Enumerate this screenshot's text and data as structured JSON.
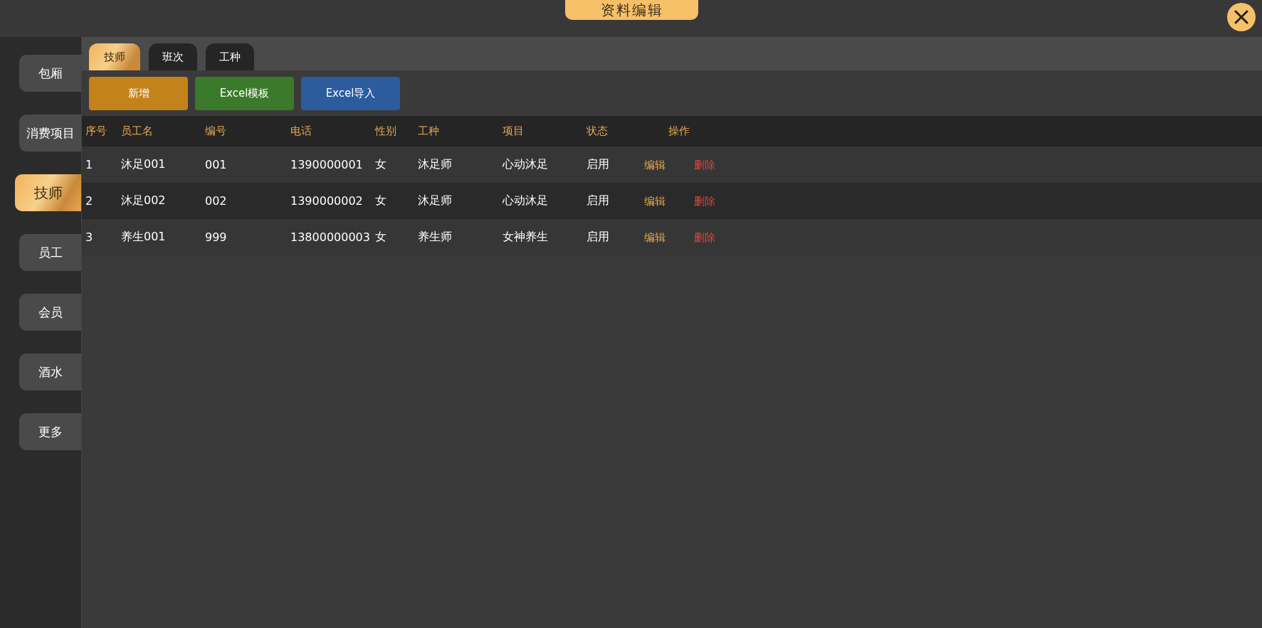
{
  "window": {
    "title": "资料编辑"
  },
  "sidebar": {
    "items": [
      {
        "label": "包厢",
        "selected": false
      },
      {
        "label": "消费项目",
        "selected": false
      },
      {
        "label": "技师",
        "selected": true
      },
      {
        "label": "员工",
        "selected": false
      },
      {
        "label": "会员",
        "selected": false
      },
      {
        "label": "酒水",
        "selected": false
      },
      {
        "label": "更多",
        "selected": false
      }
    ]
  },
  "tabs": [
    {
      "label": "技师",
      "selected": true
    },
    {
      "label": "班次",
      "selected": false
    },
    {
      "label": "工种",
      "selected": false
    }
  ],
  "buttons": [
    {
      "label": "新增",
      "kind": "add"
    },
    {
      "label": "Excel模板",
      "kind": "template"
    },
    {
      "label": "Excel导入",
      "kind": "import"
    }
  ],
  "table": {
    "columns": [
      "序号",
      "员工名",
      "编号",
      "电话",
      "性别",
      "工种",
      "项目",
      "状态",
      "操作"
    ],
    "rows": [
      {
        "cells": [
          "1",
          "沐足001",
          "001",
          "1390000001",
          "女",
          "沐足师",
          "心动沐足",
          "启用"
        ],
        "actions": [
          "编辑",
          "删除"
        ]
      },
      {
        "cells": [
          "2",
          "沐足002",
          "002",
          "1390000002",
          "女",
          "沐足师",
          "心动沐足",
          "启用"
        ],
        "actions": [
          "编辑",
          "删除"
        ]
      },
      {
        "cells": [
          "3",
          "养生001",
          "999",
          "13800000003",
          "女",
          "养生师",
          "女神养生",
          "启用"
        ],
        "actions": [
          "编辑",
          "删除"
        ]
      }
    ]
  }
}
